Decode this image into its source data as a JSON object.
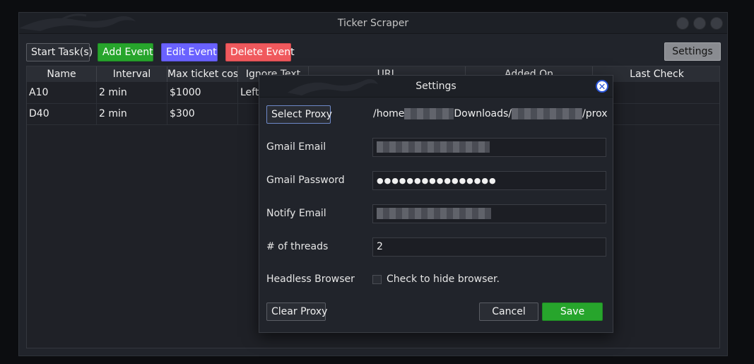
{
  "window": {
    "title": "Ticker Scraper"
  },
  "toolbar": {
    "start_label": "Start Task(s)",
    "add_label": "Add Event",
    "edit_label": "Edit Event",
    "delete_label": "Delete Event",
    "settings_label": "Settings"
  },
  "table": {
    "columns": [
      "Name",
      "Interval",
      "Max ticket cost",
      "Ignore Text",
      "URL",
      "Added On",
      "Last Check"
    ],
    "rows": [
      [
        "A10",
        "2 min",
        "$1000",
        "Left",
        "",
        "",
        ""
      ],
      [
        "D40",
        "2 min",
        "$300",
        "",
        "",
        "",
        ""
      ]
    ]
  },
  "dialog": {
    "title": "Settings",
    "select_proxy_label": "Select Proxy",
    "proxy_path": {
      "part1": "/home",
      "part2": "Downloads/",
      "part3": "/proxie"
    },
    "gmail_email_label": "Gmail Email",
    "gmail_password_label": "Gmail Password",
    "gmail_password_value": "●●●●●●●●●●●●●●●●",
    "notify_email_label": "Notify Email",
    "threads_label": "# of threads",
    "threads_value": "2",
    "headless_label": "Headless Browser",
    "headless_checkbox_label": "Check to hide browser.",
    "clear_proxy_label": "Clear Proxy",
    "cancel_label": "Cancel",
    "save_label": "Save"
  },
  "colors": {
    "add": "#27a52c",
    "edit": "#6a62ff",
    "delete": "#f0595d",
    "save": "#27a52c",
    "close_icon": "#2a55d8"
  }
}
